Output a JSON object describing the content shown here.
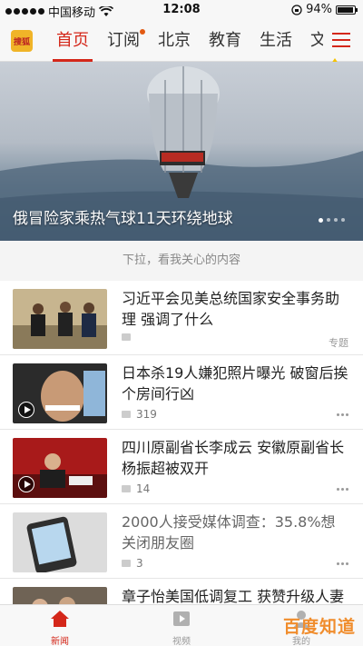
{
  "status": {
    "carrier": "中国移动",
    "time": "12:08",
    "battery": "94%"
  },
  "nav": {
    "logo": "搜狐",
    "tabs": [
      {
        "label": "首页",
        "active": true
      },
      {
        "label": "订阅",
        "badge": true
      },
      {
        "label": "北京"
      },
      {
        "label": "教育"
      },
      {
        "label": "生活"
      },
      {
        "label": "文化"
      }
    ]
  },
  "hero": {
    "title": "俄冒险家乘热气球11天环绕地球",
    "dots": 4,
    "active_dot": 0
  },
  "feed": {
    "hint": "下拉，看我关心的内容",
    "items": [
      {
        "title": "习近平会见美总统国家安全事务助理 强调了什么",
        "count": "",
        "tag": "专题"
      },
      {
        "title": "日本杀19人嫌犯照片曝光 破窗后挨个房间行凶",
        "count": "319",
        "video": true
      },
      {
        "title": "四川原副省长李成云 安徽原副省长杨振超被双开",
        "count": "14"
      },
      {
        "title": "2000人接受媒体调查：35.8%想关闭朋友圈",
        "count": "3",
        "faded": true
      },
      {
        "title": "章子怡美国低调复工 获赞升级人妻依旧少女",
        "count": ""
      }
    ]
  },
  "bottom": {
    "items": [
      {
        "label": "新闻",
        "active": true
      },
      {
        "label": "视频"
      },
      {
        "label": "我的"
      }
    ],
    "watermark": "百度知道"
  },
  "colors": {
    "accent": "#d4271a",
    "arrow": "#f5c200"
  }
}
